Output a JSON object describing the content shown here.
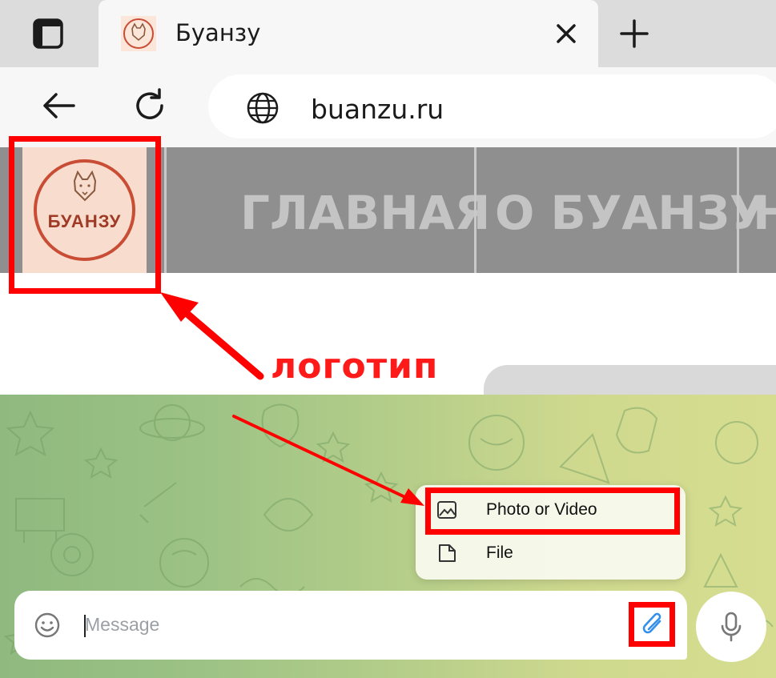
{
  "browser": {
    "tab": {
      "title": "Буанзу"
    },
    "url": "buanzu.ru"
  },
  "site": {
    "logo": {
      "text": "БУАНЗУ"
    },
    "nav": [
      "ГЛАВНАЯ",
      "О БУАНЗУ",
      "Н"
    ]
  },
  "annotation": {
    "label": "логотип",
    "color": "#ff0000"
  },
  "chat": {
    "attach_menu": [
      {
        "label": "Photo or Video",
        "icon": "photo-icon"
      },
      {
        "label": "File",
        "icon": "file-icon"
      }
    ],
    "composer": {
      "placeholder": "Message"
    }
  },
  "colors": {
    "telegram_accent": "#3390ec",
    "nav_bg": "#8f8f8f",
    "logo_bg": "#f8dccd"
  }
}
